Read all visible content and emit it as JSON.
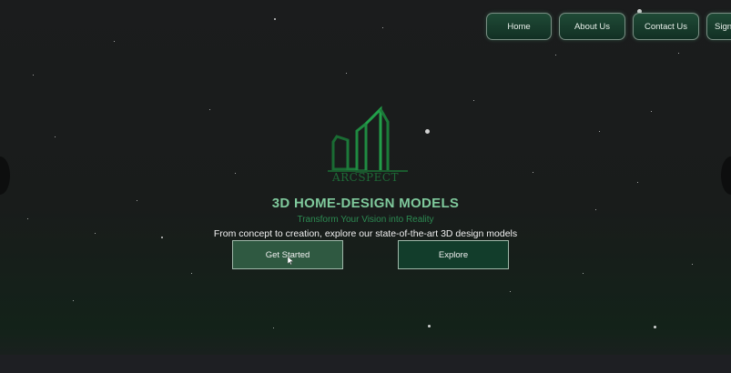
{
  "nav": {
    "home": "Home",
    "about": "About Us",
    "contact": "Contact Us",
    "sign": "Sign"
  },
  "logo": {
    "text": "ARCSPECT"
  },
  "hero": {
    "title": "3D HOME-DESIGN MODELS",
    "subtitle": "Transform Your Vision into Reality",
    "description": "From concept to creation, explore our state-of-the-art 3D design models"
  },
  "buttons": {
    "get_started": "Get Started",
    "explore": "Explore"
  },
  "colors": {
    "accent": "#2c8a52",
    "title": "#7fc99c",
    "button_primary": "#2f5941",
    "button_secondary": "#123d2b"
  }
}
